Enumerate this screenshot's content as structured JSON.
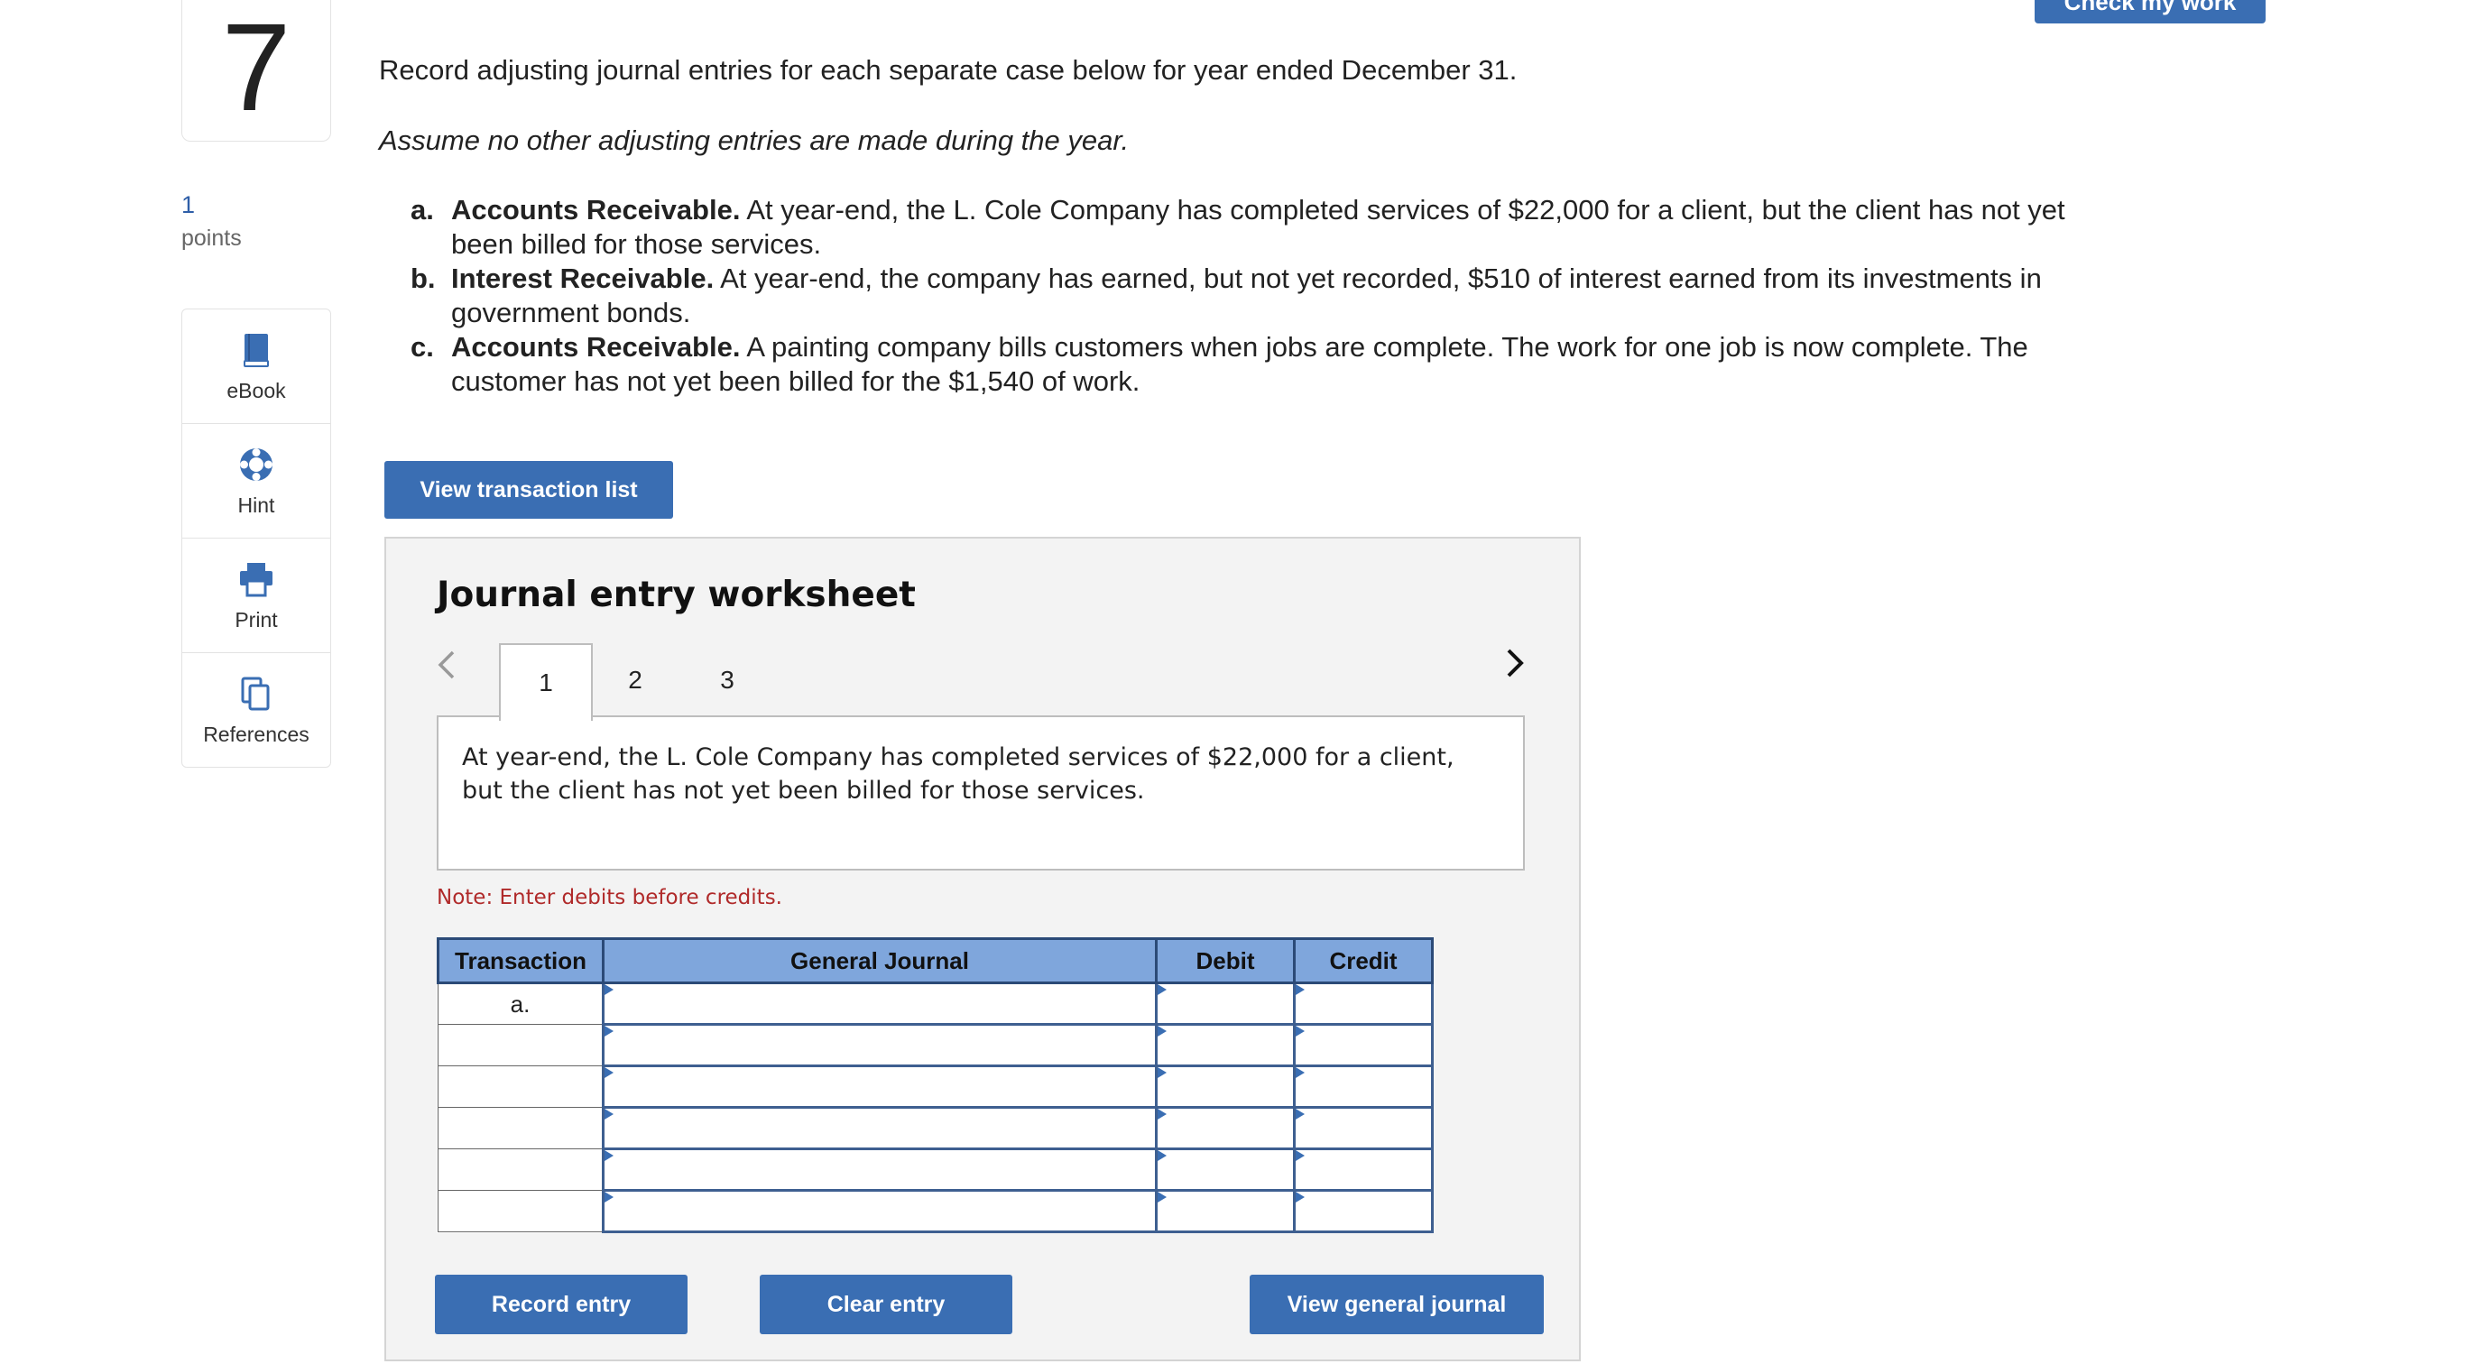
{
  "question": {
    "number": "7",
    "points_value": "1",
    "points_label": "points",
    "check_button": "Check my work",
    "prompt": "Record adjusting journal entries for each separate case below for year ended December 31.",
    "assumption": "Assume no other adjusting entries are made during the year.",
    "cases": [
      {
        "letter": "a.",
        "title": "Accounts Receivable.",
        "text": "At year-end, the L. Cole Company has completed services of $22,000 for a client, but the client has not yet been billed for those services."
      },
      {
        "letter": "b.",
        "title": "Interest Receivable.",
        "text": "At year-end, the company has earned, but not yet recorded, $510 of interest earned from its investments in government bonds."
      },
      {
        "letter": "c.",
        "title": "Accounts Receivable.",
        "text": "A painting company bills customers when jobs are complete. The work for one job is now complete. The customer has not yet been billed for the $1,540 of work."
      }
    ]
  },
  "tools": {
    "ebook": "eBook",
    "hint": "Hint",
    "print": "Print",
    "references": "References"
  },
  "view_transaction_list": "View transaction list",
  "worksheet": {
    "title": "Journal entry worksheet",
    "tabs": [
      "1",
      "2",
      "3"
    ],
    "active_tab": "1",
    "description": "At year-end, the L. Cole Company has completed services of $22,000 for a client, but the client has not yet been billed for those services.",
    "note": "Note: Enter debits before credits.",
    "columns": {
      "transaction": "Transaction",
      "general_journal": "General Journal",
      "debit": "Debit",
      "credit": "Credit"
    },
    "rows": [
      {
        "transaction": "a.",
        "account": "",
        "debit": "",
        "credit": ""
      },
      {
        "transaction": "",
        "account": "",
        "debit": "",
        "credit": ""
      },
      {
        "transaction": "",
        "account": "",
        "debit": "",
        "credit": ""
      },
      {
        "transaction": "",
        "account": "",
        "debit": "",
        "credit": ""
      },
      {
        "transaction": "",
        "account": "",
        "debit": "",
        "credit": ""
      },
      {
        "transaction": "",
        "account": "",
        "debit": "",
        "credit": ""
      }
    ],
    "buttons": {
      "record": "Record entry",
      "clear": "Clear entry",
      "view_journal": "View general journal"
    }
  },
  "colors": {
    "accent": "#3a6eb3",
    "header_fill": "#7fa6dc",
    "note": "#b02a2a"
  }
}
